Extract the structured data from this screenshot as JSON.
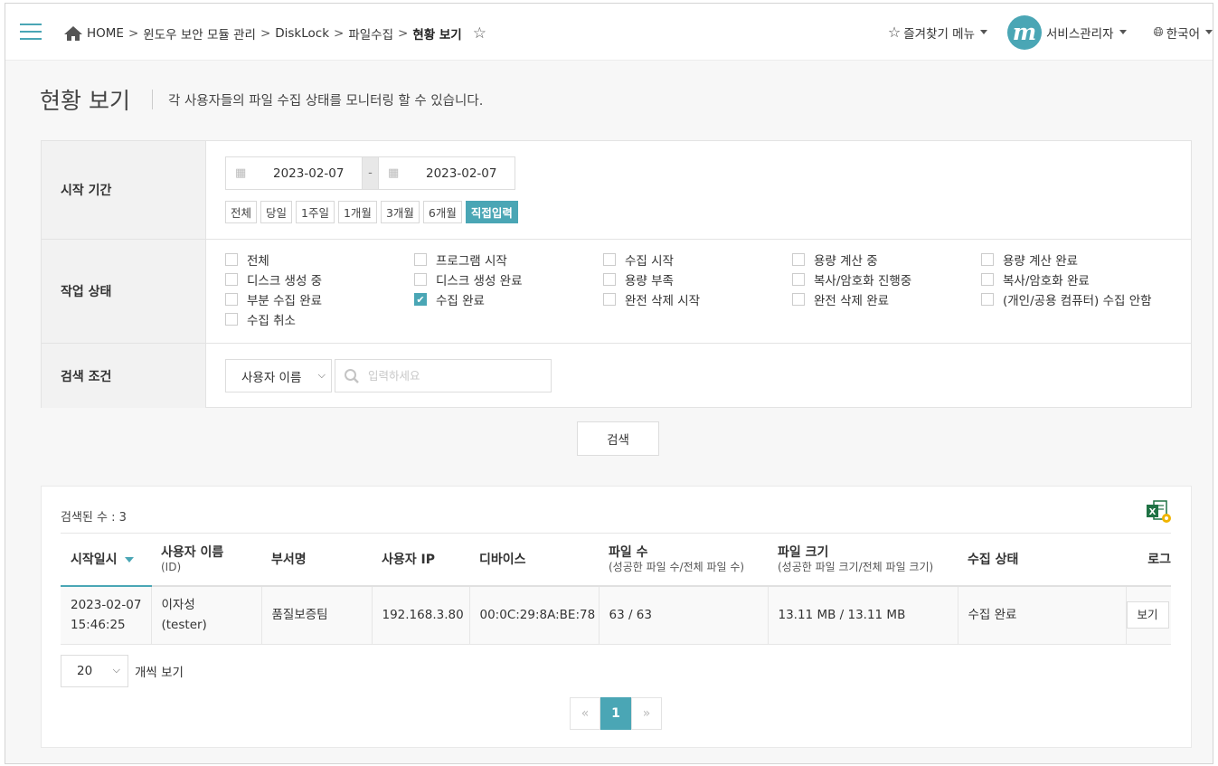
{
  "breadcrumb": {
    "items": [
      "HOME",
      "윈도우 보안 모듈 관리",
      "DiskLock",
      "파일수집"
    ],
    "current": "현황 보기",
    "separator": ">"
  },
  "header": {
    "favorites_label": "즐겨찾기 메뉴",
    "avatar_letter": "m",
    "user_label": "서비스관리자",
    "language_label": "한국어"
  },
  "page": {
    "title": "현황 보기",
    "description": "각 사용자들의 파일 수집 상태를 모니터링 할 수 있습니다."
  },
  "filters": {
    "period": {
      "label": "시작 기간",
      "start_date": "2023-02-07",
      "end_date": "2023-02-07",
      "dash": "-",
      "quick_buttons": [
        "전체",
        "당일",
        "1주일",
        "1개월",
        "3개월",
        "6개월",
        "직접입력"
      ],
      "active_quick": "직접입력"
    },
    "status": {
      "label": "작업 상태",
      "options": [
        {
          "label": "전체",
          "checked": false
        },
        {
          "label": "프로그램 시작",
          "checked": false
        },
        {
          "label": "수집 시작",
          "checked": false
        },
        {
          "label": "용량 계산 중",
          "checked": false
        },
        {
          "label": "용량 계산 완료",
          "checked": false
        },
        {
          "label": "디스크 생성 중",
          "checked": false
        },
        {
          "label": "디스크 생성 완료",
          "checked": false
        },
        {
          "label": "용량 부족",
          "checked": false
        },
        {
          "label": "복사/암호화 진행중",
          "checked": false
        },
        {
          "label": "복사/암호화 완료",
          "checked": false
        },
        {
          "label": "부분 수집 완료",
          "checked": false
        },
        {
          "label": "수집 완료",
          "checked": true
        },
        {
          "label": "완전 삭제 시작",
          "checked": false
        },
        {
          "label": "완전 삭제 완료",
          "checked": false
        },
        {
          "label": "(개인/공용 컴퓨터) 수집 안함",
          "checked": false
        },
        {
          "label": "수집 취소",
          "checked": false
        }
      ]
    },
    "search": {
      "label": "검색 조건",
      "field_selected": "사용자 이름",
      "placeholder": "입력하세요",
      "value": ""
    },
    "search_button": "검색"
  },
  "results": {
    "count_text": "검색된 수 : 3",
    "columns": [
      {
        "main": "시작일시",
        "sub": ""
      },
      {
        "main": "사용자 이름",
        "sub": "(ID)"
      },
      {
        "main": "부서명",
        "sub": ""
      },
      {
        "main": "사용자 IP",
        "sub": ""
      },
      {
        "main": "디바이스",
        "sub": ""
      },
      {
        "main": "파일 수",
        "sub": "(성공한 파일 수/전체 파일 수)"
      },
      {
        "main": "파일 크기",
        "sub": "(성공한 파일 크기/전체 파일 크기)"
      },
      {
        "main": "수집 상태",
        "sub": ""
      },
      {
        "main": "로그",
        "sub": ""
      }
    ],
    "rows": [
      {
        "date": "2023-02-07",
        "time": "15:46:25",
        "user_name": "이자성",
        "user_id": "(tester)",
        "dept": "품질보증팀",
        "ip": "192.168.3.80",
        "device": "00:0C:29:8A:BE:78",
        "files": "63 / 63",
        "size": "13.11 MB / 13.11 MB",
        "status": "수집 완료",
        "log_button": "보기"
      }
    ],
    "page_size": "20",
    "page_size_label": "개씩 보기",
    "pagination": {
      "prev": "«",
      "current": "1",
      "next": "»"
    }
  },
  "colors": {
    "accent": "#4aa6b5"
  }
}
